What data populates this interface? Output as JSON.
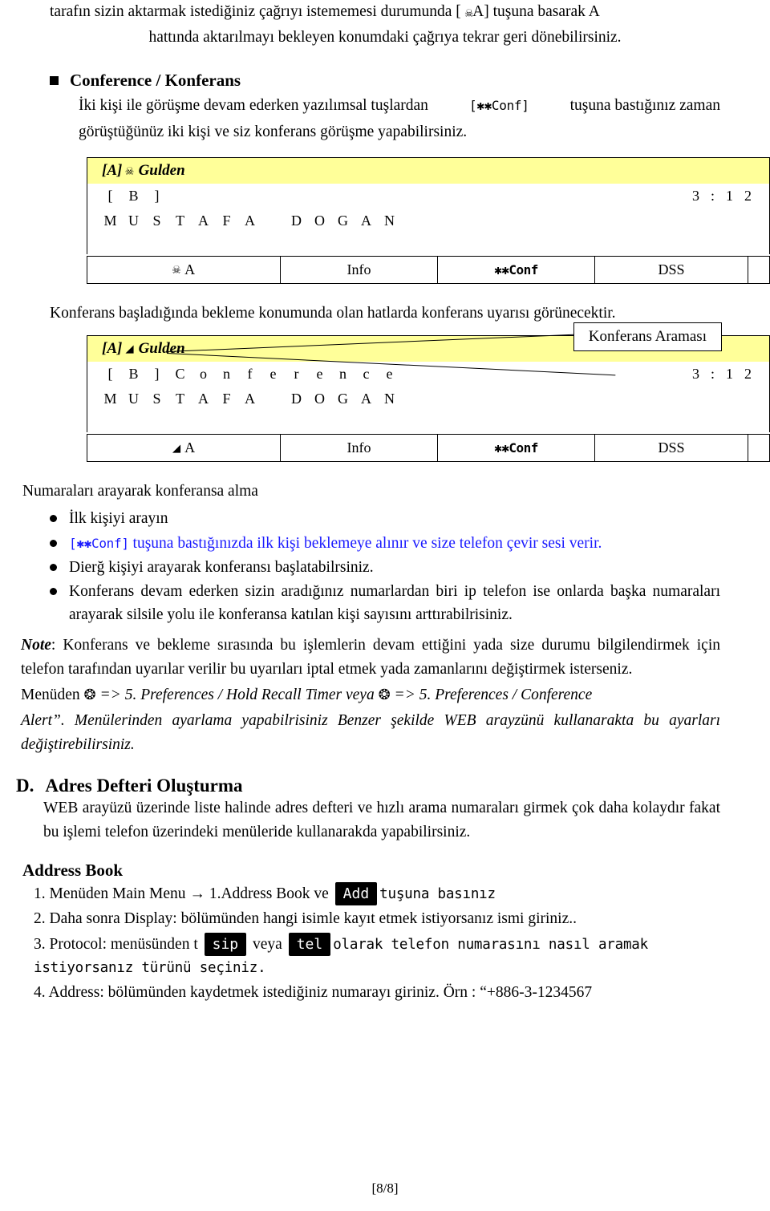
{
  "intro": {
    "line1_a": "tarafın sizin aktarmak istediğiniz çağrıyı istememesi durumunda [",
    "line1_key": "A]",
    "line1_b": " tuşuna basarak A",
    "line2": "hattında aktarılmayı bekleyen konumdaki çağrıya tekrar geri dönebilirsiniz."
  },
  "conference": {
    "heading": "Conference / Konferans",
    "para_a": "İki kişi ile görüşme devam ederken yazılımsal tuşlardan",
    "key_conf": "[✱✱Conf]",
    "para_b": "tuşuna bastığınız zaman",
    "para_c": "görüştüğünüz iki kişi ve siz konferans görüşme yapabilirsiniz."
  },
  "phone1": {
    "title_prefix": "[A]",
    "title_icon": "handset-icon",
    "title_name": "Gulden",
    "row_cells": [
      "[",
      "B",
      "]"
    ],
    "clock": [
      "3",
      ":",
      "1",
      "2"
    ],
    "row2_cells": [
      "M",
      "U",
      "S",
      "T",
      "A",
      "F",
      "A",
      "",
      "D",
      "O",
      "G",
      "A",
      "N"
    ],
    "softkeys": [
      {
        "glyph": "handset-icon",
        "label": "A"
      },
      {
        "label": "Info"
      },
      {
        "label": "✱✱Conf"
      },
      {
        "label": "DSS"
      },
      {
        "label": ""
      }
    ]
  },
  "mid_text": "Konferans başladığında bekleme konumunda olan hatlarda konferans uyarısı görünecektir.",
  "phone2": {
    "callout": "Konferans Araması",
    "title_prefix": "[A]",
    "title_icon": "arrow-icon",
    "title_name": "Gulden",
    "row_cells": [
      "[",
      "B",
      "]",
      "C",
      "o",
      "n",
      "f",
      "e",
      "r",
      "e",
      "n",
      "c",
      "e"
    ],
    "clock": [
      "3",
      ":",
      "1",
      "2"
    ],
    "row2_cells": [
      "M",
      "U",
      "S",
      "T",
      "A",
      "F",
      "A",
      "",
      "D",
      "O",
      "G",
      "A",
      "N"
    ],
    "softkeys": [
      {
        "glyph": "arrow-icon",
        "label": "A"
      },
      {
        "label": "Info"
      },
      {
        "label": "✱✱Conf"
      },
      {
        "label": "DSS"
      },
      {
        "label": ""
      }
    ]
  },
  "dial_section": {
    "heading": "Numaraları arayarak konferansa alma",
    "bullets": [
      {
        "text": "İlk kişiyi arayın"
      },
      {
        "key": "[✱✱Conf]",
        "text": " tuşuna bastığınızda ilk kişi beklemeye alınır ve size telefon çevir sesi verir.",
        "color": "#1a1aff"
      },
      {
        "text": "Dierğ kişiyi arayarak konferansı başlatabilrsiniz."
      },
      {
        "text": "Konferans devam ederken sizin aradığınız numarlardan biri ip telefon ise onlarda başka numaraları arayarak silsile yolu ile konferansa katılan kişi sayısını arttırabilrisiniz."
      }
    ]
  },
  "note": {
    "label": "Note",
    "colon": ":",
    "p1": "Konferans ve bekleme sırasında bu işlemlerin devam ettiğini yada size durumu bilgilendirmek için telefon tarafından uyarılar verilir bu uyarıları iptal etmek yada zamanlarını değiştirmek isterseniz.",
    "menu_prefix": "Menüden",
    "menu_icon": "wrench-icon",
    "menu_arrow1": "=> 5. Preferences / Hold Recall Timer veya",
    "menu_arrow2": "=> 5. Preferences / Conference",
    "p2_italic": "Alert”. Menülerinden ayarlama yapabilrisiniz Benzer şekilde WEB arayzünü kullanarakta bu ayarları değiştirebilirsiniz."
  },
  "section_d": {
    "letter": "D.",
    "title": "Adres Defteri Oluşturma",
    "body": "WEB arayüzü üzerinde liste halinde adres defteri ve hızlı arama numaraları girmek çok daha kolaydır fakat bu işlemi telefon üzerindeki menüleride kullanarakda yapabilirsiniz."
  },
  "address_book": {
    "heading": "Address Book",
    "steps": [
      {
        "num": "1.",
        "pre": "Menüden  Main Menu ",
        "arrow": "→",
        "mid": " 1.Address Book ve ",
        "keycap": "Add",
        "post": "tuşuna basınız"
      },
      {
        "num": "2.",
        "pre": "Daha sonra  Display:  bölümünden hangi isimle kayıt etmek istiyorsanız ismi giriniz.."
      },
      {
        "num": "3.",
        "pre": "Protocol:  menüsünden t ",
        "keycap1": "sip",
        "mid": " veya ",
        "keycap2": "tel",
        "post": "olarak telefon numarasını nasıl aramak istiyorsanız türünü seçiniz."
      },
      {
        "num": "4.",
        "pre": "Address:  bölümünden kaydetmek istediğiniz numarayı giriniz. Örn : “+886-3-1234567"
      }
    ]
  },
  "footer": "[8/8]"
}
